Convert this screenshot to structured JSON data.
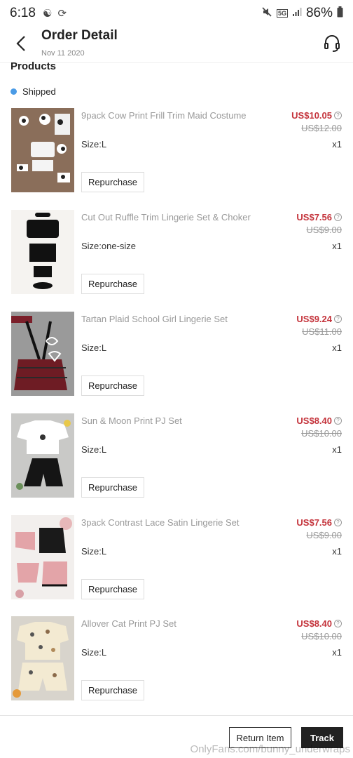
{
  "status_bar": {
    "time": "6:18",
    "battery": "86%",
    "network_badge": "5G"
  },
  "header": {
    "title": "Order Detail",
    "date": "Nov 11 2020"
  },
  "products_section": {
    "title": "Products",
    "status": "Shipped",
    "status_color": "#4a9be6"
  },
  "products": [
    {
      "name": "9pack Cow Print Frill Trim Maid Costume",
      "size": "Size:L",
      "price": "US$10.05",
      "original_price": "US$12.00",
      "qty": "x1",
      "repurchase": "Repurchase"
    },
    {
      "name": "Cut Out Ruffle Trim Lingerie Set & Choker",
      "size": "Size:one-size",
      "price": "US$7.56",
      "original_price": "US$9.00",
      "qty": "x1",
      "repurchase": "Repurchase"
    },
    {
      "name": "Tartan Plaid School Girl Lingerie Set",
      "size": "Size:L",
      "price": "US$9.24",
      "original_price": "US$11.00",
      "qty": "x1",
      "repurchase": "Repurchase"
    },
    {
      "name": "Sun & Moon Print PJ Set",
      "size": "Size:L",
      "price": "US$8.40",
      "original_price": "US$10.00",
      "qty": "x1",
      "repurchase": "Repurchase"
    },
    {
      "name": "3pack Contrast Lace Satin Lingerie Set",
      "size": "Size:L",
      "price": "US$7.56",
      "original_price": "US$9.00",
      "qty": "x1",
      "repurchase": "Repurchase"
    },
    {
      "name": "Allover Cat Print PJ Set",
      "size": "Size:L",
      "price": "US$8.40",
      "original_price": "US$10.00",
      "qty": "x1",
      "repurchase": "Repurchase"
    }
  ],
  "bottom_bar": {
    "return_label": "Return Item",
    "track_label": "Track"
  },
  "watermark": "OnlyFans.com/bunny_underwraps",
  "colors": {
    "sale_price": "#c4333b",
    "track_button": "#222222"
  }
}
